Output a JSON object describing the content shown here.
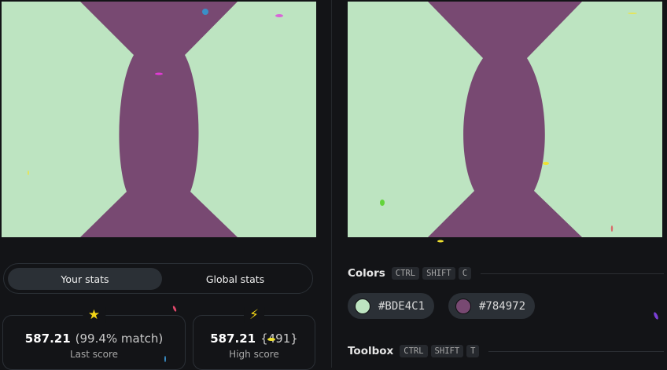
{
  "colors": {
    "background": "#BDE4C1",
    "shape": "#784972",
    "page_background": "#131417",
    "panel": "#2b3036"
  },
  "stats_tabs": {
    "your_stats": "Your stats",
    "global_stats": "Global stats"
  },
  "last_score": {
    "icon": "star-icon",
    "value": "587.21",
    "detail": "(99.4% match)",
    "label": "Last score"
  },
  "high_score": {
    "icon": "lightning-icon",
    "value": "587.21",
    "detail": "{491}",
    "label": "High score"
  },
  "colors_section": {
    "title": "Colors",
    "shortcut": [
      "CTRL",
      "SHIFT",
      "C"
    ],
    "chips": [
      {
        "hex": "#BDE4C1"
      },
      {
        "hex": "#784972"
      }
    ]
  },
  "toolbox_section": {
    "title": "Toolbox",
    "shortcut": [
      "CTRL",
      "SHIFT",
      "T"
    ]
  }
}
